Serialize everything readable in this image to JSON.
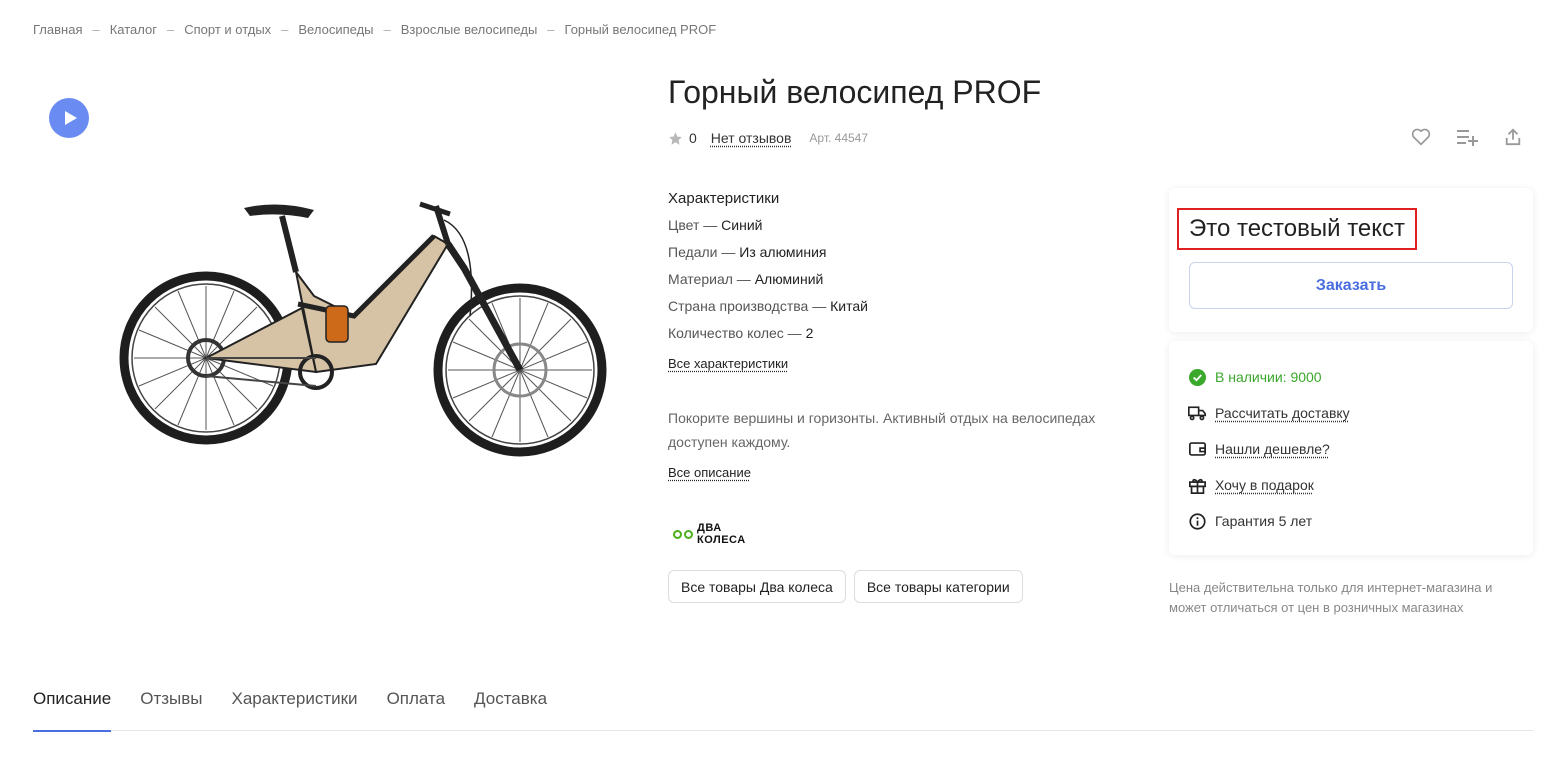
{
  "breadcrumbs": [
    "Главная",
    "Каталог",
    "Спорт и отдых",
    "Велосипеды",
    "Взрослые велосипеды",
    "Горный велосипед PROF"
  ],
  "breadcrumb_separator": "–",
  "product": {
    "title": "Горный велосипед PROF",
    "rating": "0",
    "reviews_link": "Нет отзывов",
    "article": "Арт. 44547",
    "image_icon": "mountain-bike-image"
  },
  "specs": {
    "title": "Характеристики",
    "rows": [
      {
        "label": "Цвет — ",
        "value": "Синий"
      },
      {
        "label": "Педали — ",
        "value": "Из алюминия"
      },
      {
        "label": "Материал — ",
        "value": "Алюминий"
      },
      {
        "label": "Страна производства — ",
        "value": "Китай"
      },
      {
        "label": "Количество колес — ",
        "value": "2"
      }
    ],
    "all_link": "Все характеристики"
  },
  "description": {
    "text": "Покорите вершины и горизонты. Активный отдых на велосипедах доступен каждому.",
    "all_link": "Все описание"
  },
  "brand": {
    "line1": "ДВА",
    "line2": "КОЛЕСА",
    "color": "#4caf1e"
  },
  "chips": [
    "Все товары Два колеса",
    "Все товары категории"
  ],
  "buy": {
    "test_text": "Это тестовый текст",
    "order_button": "Заказать",
    "accent_color": "#4a6ee0",
    "highlight_color": "#e02020"
  },
  "info": {
    "stock": "В наличии: 9000",
    "delivery": "Рассчитать доставку",
    "cheaper": "Нашли дешевле?",
    "gift": "Хочу в подарок",
    "warranty": "Гарантия 5 лет",
    "stock_color": "#3aa82a"
  },
  "price_note": "Цена действительна только для интернет-магазина и может отличаться от цен в розничных магазинах",
  "tabs": [
    "Описание",
    "Отзывы",
    "Характеристики",
    "Оплата",
    "Доставка"
  ],
  "active_tab": "Описание"
}
